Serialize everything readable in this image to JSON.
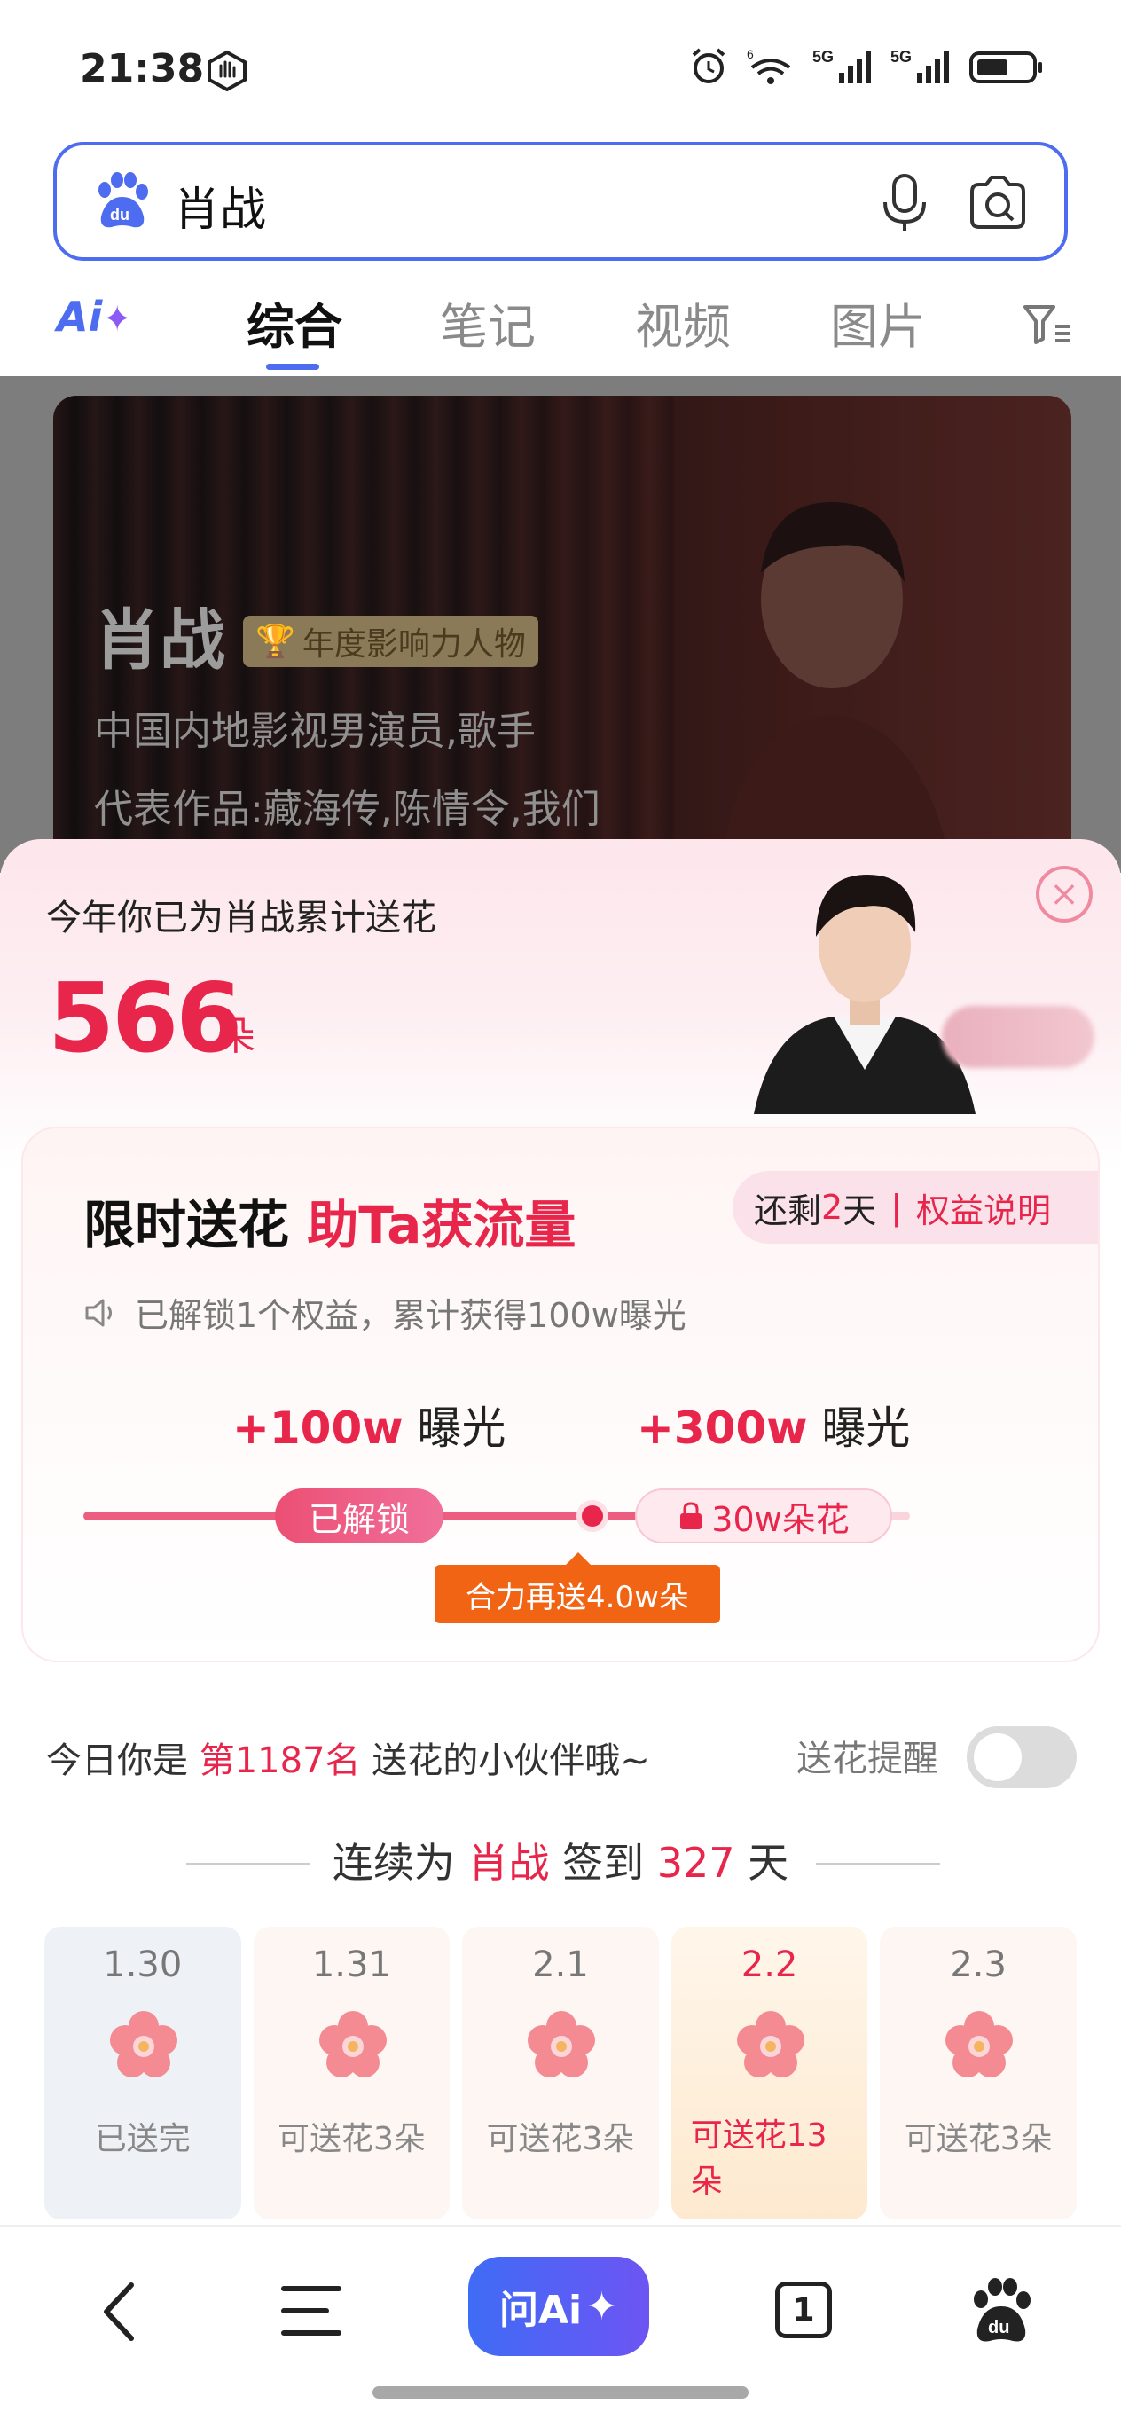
{
  "status_bar": {
    "time": "21:38",
    "signal_icons": [
      "alarm-icon",
      "wifi-6-icon",
      "5g-signal-icon",
      "5g-signal-icon",
      "battery-icon"
    ]
  },
  "search": {
    "query": "肖战",
    "icons": [
      "baidu-paw-icon",
      "microphone-icon",
      "camera-search-icon"
    ]
  },
  "tabs": {
    "ai_label": "Ai",
    "items": [
      "综合",
      "笔记",
      "视频",
      "图片"
    ],
    "active": "综合"
  },
  "hero": {
    "name": "肖战",
    "award": "年度影响力人物",
    "description": "中国内地影视男演员,歌手",
    "works": "代表作品:藏海传,陈情令,我们"
  },
  "sheet": {
    "title": "今年你已为肖战累计送花",
    "count": "566",
    "unit": "朵",
    "close_label": "×"
  },
  "reward_card": {
    "headline_plain": "限时送花 ",
    "headline_highlight": "助Ta获流量",
    "remain_prefix": "还剩",
    "remain_days": "2",
    "remain_suffix": "天",
    "separator": "|",
    "rights_link": "权益说明",
    "notice": "已解锁1个权益，累计获得100w曝光",
    "gain1_value": "+100w",
    "gain1_label": " 曝光",
    "gain2_value": "+300w",
    "gain2_label": " 曝光",
    "unlocked_label": "已解锁",
    "locked_label": "30w朵花",
    "tip": "合力再送4.0w朵"
  },
  "rank": {
    "prefix": "今日你是 ",
    "highlight": "第1187名",
    "suffix": " 送花的小伙伴哦~",
    "remind_label": "送花提醒",
    "remind_on": false
  },
  "signin": {
    "prefix": "连续为 ",
    "name": "肖战",
    "middle": " 签到 ",
    "days": "327",
    "suffix": " 天"
  },
  "days": [
    {
      "date": "1.30",
      "label": "已送完",
      "state": "done"
    },
    {
      "date": "1.31",
      "label": "可送花3朵",
      "state": "available"
    },
    {
      "date": "2.1",
      "label": "可送花3朵",
      "state": "available"
    },
    {
      "date": "2.2",
      "label": "可送花13朵",
      "state": "today"
    },
    {
      "date": "2.3",
      "label": "可送花3朵",
      "state": "available"
    }
  ],
  "bottom_nav": {
    "ask_ai_label": "问Ai",
    "tabs_count": "1"
  },
  "colors": {
    "accent": "#e8264b",
    "brand_blue": "#4e6cf0",
    "tip_orange": "#f06414"
  }
}
